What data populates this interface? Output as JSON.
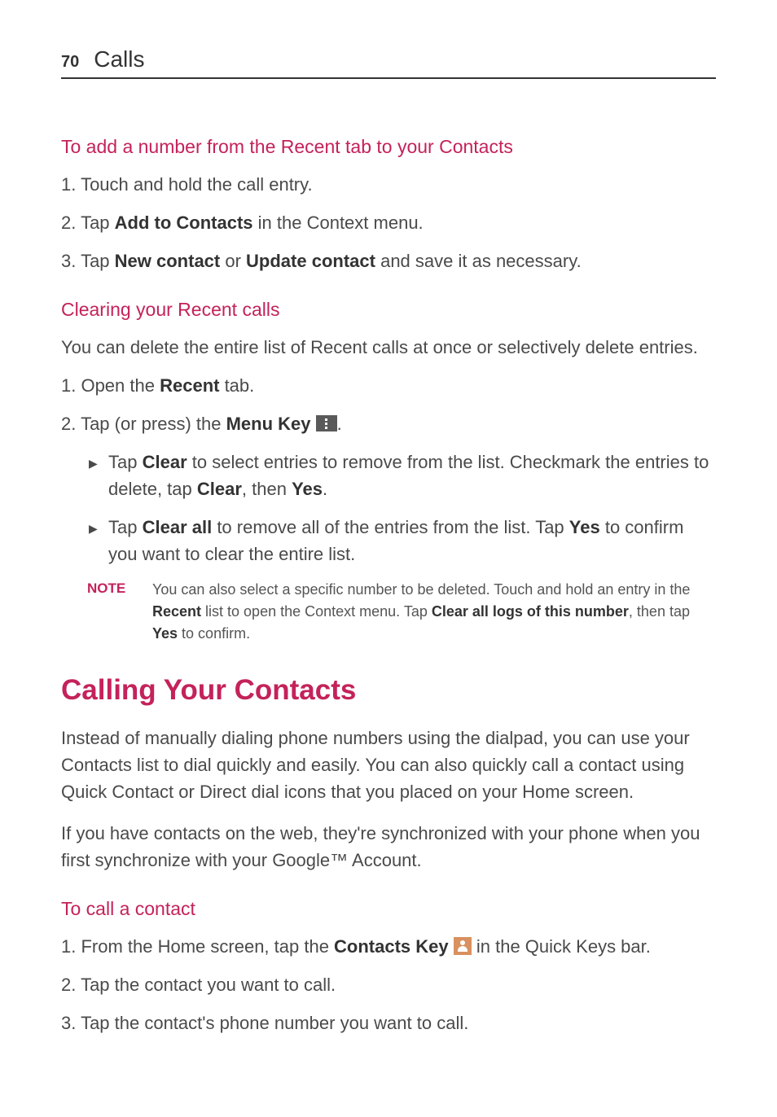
{
  "header": {
    "page_number": "70",
    "section": "Calls"
  },
  "sub1": {
    "title": "To add a number from the Recent tab to your Contacts",
    "step1_pre": "1.  Touch and hold the call entry.",
    "step2_pre": "2.  Tap ",
    "step2_bold": "Add to Contacts",
    "step2_post": " in the Context menu.",
    "step3_pre": "3.  Tap ",
    "step3_b1": "New contact",
    "step3_mid": " or ",
    "step3_b2": "Update contact",
    "step3_post": " and save it as necessary."
  },
  "sub2": {
    "title": "Clearing your Recent calls",
    "intro": "You can delete the entire list of Recent calls at once or selectively delete entries.",
    "step1_pre": "1.  Open the ",
    "step1_bold": "Recent",
    "step1_post": " tab.",
    "step2_pre": "2.  Tap (or press) the ",
    "step2_bold": "Menu Key",
    "step2_post": ".",
    "bullet1_pre": "Tap ",
    "bullet1_b1": "Clear",
    "bullet1_mid1": " to select entries to remove from the list. Checkmark the entries to delete, tap ",
    "bullet1_b2": "Clear",
    "bullet1_mid2": ", then ",
    "bullet1_b3": "Yes",
    "bullet1_post": ".",
    "bullet2_pre": "Tap ",
    "bullet2_b1": "Clear all",
    "bullet2_mid1": " to remove all of the entries from the list. Tap ",
    "bullet2_b2": "Yes",
    "bullet2_post": " to confirm you want to clear the entire list.",
    "note_label": "NOTE",
    "note_pre": "You can also select a specific number to be deleted. Touch and hold an entry in the ",
    "note_b1": "Recent",
    "note_mid1": " list to open the Context menu. Tap ",
    "note_b2": "Clear all logs of this number",
    "note_mid2": ", then tap ",
    "note_b3": "Yes",
    "note_post": " to confirm."
  },
  "heading2": "Calling Your Contacts",
  "para1": "Instead of manually dialing phone numbers using the dialpad, you can use your Contacts list to dial quickly and easily. You can also quickly call a contact using Quick Contact or Direct dial icons that you placed on your Home screen.",
  "para2": "If you have contacts on the web, they're synchronized with your phone when you first synchronize with your Google™ Account.",
  "sub3": {
    "title": "To call a contact",
    "step1_pre": "1.  From the Home screen, tap the ",
    "step1_bold": "Contacts Key",
    "step1_post": " in the Quick Keys bar.",
    "step2": "2.  Tap the contact you want to call.",
    "step3": "3.  Tap the contact's phone number you want to call."
  }
}
